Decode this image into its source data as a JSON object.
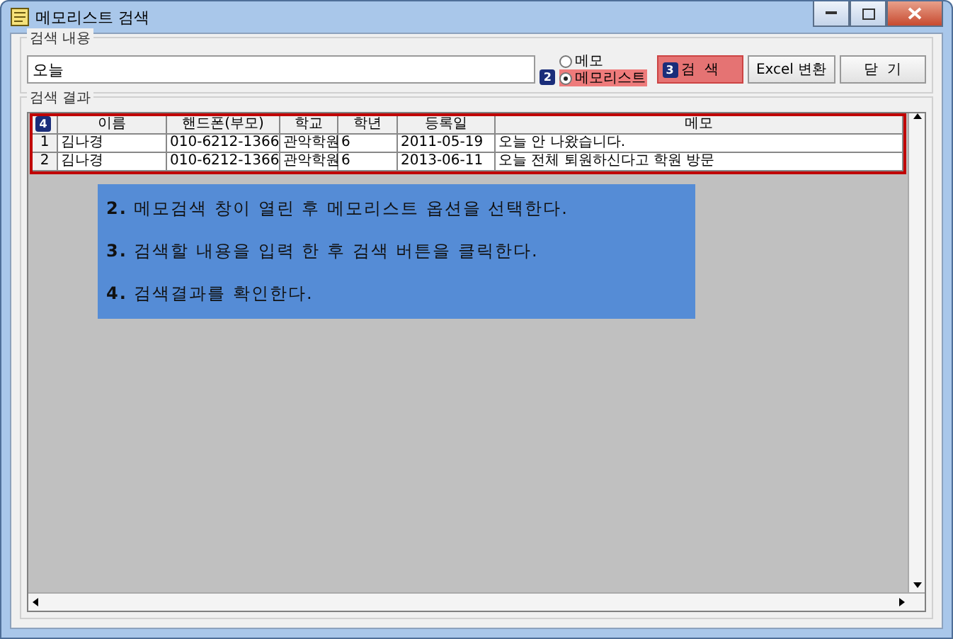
{
  "window": {
    "title": "메모리스트 검색"
  },
  "search_group": {
    "label": "검색 내용",
    "value": "오늘",
    "options": [
      {
        "label": "메모",
        "selected": false,
        "highlighted": false
      },
      {
        "label": "메모리스트",
        "selected": true,
        "highlighted": true,
        "badge": "2"
      }
    ],
    "buttons": [
      {
        "label": "검  색",
        "highlighted": true,
        "badge": "3"
      },
      {
        "label": "Excel 변환",
        "highlighted": false
      },
      {
        "label": "닫  기",
        "highlighted": false
      }
    ]
  },
  "results_group": {
    "label": "검색 결과",
    "corner_badge": "4",
    "columns": [
      "이름",
      "핸드폰(부모)",
      "학교",
      "학년",
      "등록일",
      "메모"
    ],
    "rows": [
      {
        "number": "1",
        "cells": [
          "김나경",
          "010-6212-1366",
          "관악학원",
          "6",
          "2011-05-19",
          "오늘 안 나왔습니다."
        ]
      },
      {
        "number": "2",
        "cells": [
          "김나경",
          "010-6212-1366",
          "관악학원",
          "6",
          "2013-06-11",
          "오늘 전체 퇴원하신다고 학원 방문"
        ]
      }
    ]
  },
  "callout": {
    "steps": [
      "**2.** 메모검색 창이 열린 후 메모리스트 옵션을 선택한다.",
      "**3.** 검색할 내용을 입력 한 후 검색 버튼을 클릭한다.",
      "**4.** 검색결과를 확인한다."
    ]
  }
}
